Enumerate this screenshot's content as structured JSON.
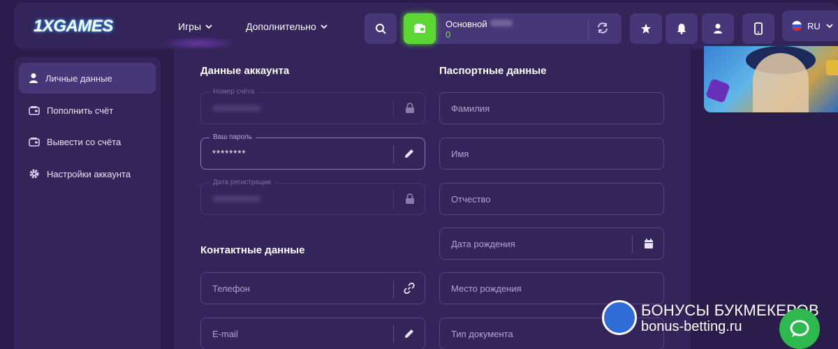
{
  "header": {
    "logo": "1XGAMES",
    "nav": [
      {
        "label": "Игры"
      },
      {
        "label": "Дополнительно"
      }
    ],
    "balance": {
      "name": "Основной",
      "value": "0"
    },
    "lang": "RU"
  },
  "sidebar": {
    "items": [
      {
        "label": "Личные данные",
        "icon": "user-icon"
      },
      {
        "label": "Пополнить счёт",
        "icon": "wallet-icon"
      },
      {
        "label": "Вывести со счёта",
        "icon": "wallet-icon"
      },
      {
        "label": "Настройки аккаунта",
        "icon": "gear-icon"
      }
    ]
  },
  "account": {
    "title": "Данные аккаунта",
    "account_number_label": "Номер счёта",
    "password_label": "Ваш пароль",
    "password_value": "********",
    "reg_date_label": "Дата регистрации"
  },
  "contacts": {
    "title": "Контактные данные",
    "phone_placeholder": "Телефон",
    "email_placeholder": "E-mail"
  },
  "passport": {
    "title": "Паспортные данные",
    "fields": [
      {
        "placeholder": "Фамилия"
      },
      {
        "placeholder": "Имя"
      },
      {
        "placeholder": "Отчество"
      },
      {
        "placeholder": "Дата рождения"
      },
      {
        "placeholder": "Место рождения"
      },
      {
        "placeholder": "Тип документа"
      }
    ]
  },
  "watermark": {
    "line1": "БОНУСЫ БУКМЕКЕРОВ",
    "line2": "bonus-betting.ru"
  },
  "colors": {
    "background": "#2a1d4b",
    "panel": "#33245a",
    "button": "#463779",
    "accent_green": "#5cd632",
    "balance_value": "#7ee23a"
  }
}
